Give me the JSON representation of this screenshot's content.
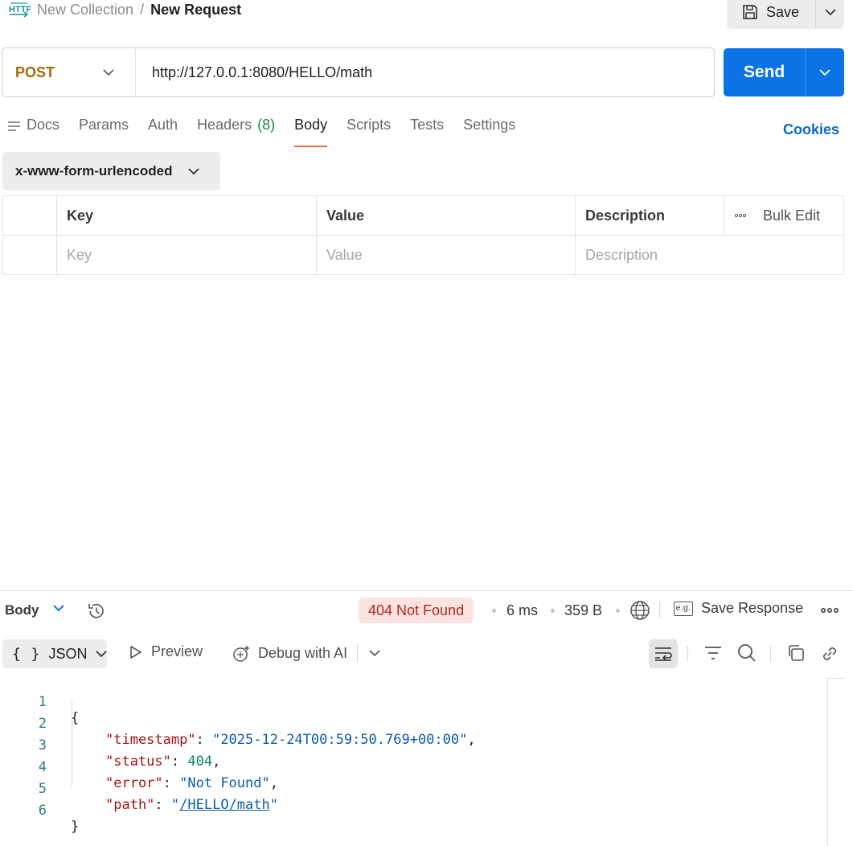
{
  "header": {
    "icon": "http-file-icon",
    "breadcrumb_parent": "New Collection",
    "breadcrumb_sep": "/",
    "breadcrumb_current": "New Request",
    "save_label": "Save"
  },
  "request": {
    "method": "POST",
    "url": "http://127.0.0.1:8080/HELLO/math",
    "send_label": "Send"
  },
  "tabs": [
    {
      "label": "Docs",
      "icon": "docs-icon"
    },
    {
      "label": "Params"
    },
    {
      "label": "Auth"
    },
    {
      "label": "Headers",
      "count": "(8)"
    },
    {
      "label": "Body",
      "active": true
    },
    {
      "label": "Scripts"
    },
    {
      "label": "Tests"
    },
    {
      "label": "Settings"
    }
  ],
  "cookies_label": "Cookies",
  "body_type": "x-www-form-urlencoded",
  "params_table": {
    "headers": {
      "key": "Key",
      "value": "Value",
      "description": "Description",
      "bulk_edit": "Bulk Edit"
    },
    "placeholders": {
      "key": "Key",
      "value": "Value",
      "description": "Description"
    }
  },
  "response": {
    "body_label": "Body",
    "status": "404 Not Found",
    "time": "6 ms",
    "size": "359 B",
    "save_response": "Save Response",
    "save_icon_text": "e.g.",
    "format": "JSON",
    "format_braces": "{ }",
    "preview": "Preview",
    "debug": "Debug with AI"
  },
  "code_lines": [
    {
      "num": "1",
      "open": "{"
    },
    {
      "num": "2",
      "key": "\"timestamp\"",
      "colon": ": ",
      "value": "\"2025-12-24T00:59:50.769+00:00\"",
      "end": ","
    },
    {
      "num": "3",
      "key": "\"status\"",
      "colon": ": ",
      "value": "404",
      "end": ","
    },
    {
      "num": "4",
      "key": "\"error\"",
      "colon": ": ",
      "value": "\"Not Found\"",
      "end": ","
    },
    {
      "num": "5",
      "key": "\"path\"",
      "colon": ": ",
      "q1": "\"",
      "link": "/HELLO/math",
      "q2": "\""
    },
    {
      "num": "6",
      "close": "}"
    }
  ],
  "colors": {
    "send": "#0b73e6",
    "method": "#a36a05",
    "active_tab_underline": "#f26b3a",
    "status_bg": "#fde4e1",
    "status_text": "#b3261e",
    "cookies": "#0b6bcb",
    "headers_count": "#1f8a4c"
  }
}
